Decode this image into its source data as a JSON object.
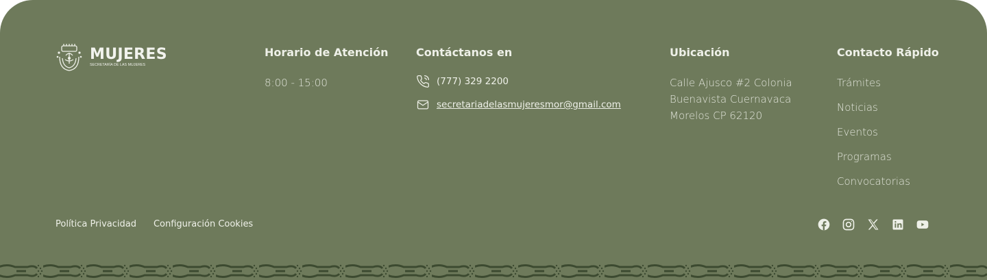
{
  "logo": {
    "title": "MUJERES",
    "subtitle": "SECRETARÍA DE LAS MUJERES"
  },
  "horario": {
    "title": "Horario de Atención",
    "hours": "8:00 - 15:00"
  },
  "contact": {
    "title": "Contáctanos en",
    "phone": "(777) 329 2200",
    "email": "secretariadelasmujeresmor@gmail.com"
  },
  "ubicacion": {
    "title": "Ubicación",
    "lines": [
      "Calle Ajusco #2 Colonia",
      "Buenavista Cuernavaca",
      "Morelos CP 62120"
    ]
  },
  "rapido": {
    "title": "Contacto Rápido",
    "links": [
      "Trámites",
      "Noticias",
      "Eventos",
      "Programas",
      "Convocatorias"
    ]
  },
  "legal": {
    "privacy": "Política Privacidad",
    "cookies": "Configuración Cookies"
  },
  "social": [
    "facebook-icon",
    "instagram-icon",
    "x-icon",
    "linkedin-icon",
    "youtube-icon"
  ],
  "colors": {
    "background": "#6e7a5b",
    "text": "#eef0e8",
    "pattern": "#3c4a30"
  }
}
